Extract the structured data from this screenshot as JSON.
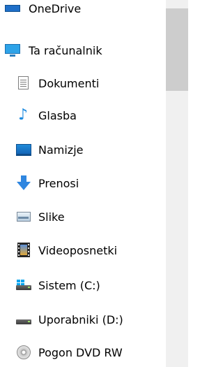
{
  "nav": {
    "partial_item": {
      "label": "OneDrive",
      "icon": "onedrive-icon"
    },
    "this_pc": {
      "label": "Ta računalnik",
      "icon": "computer-icon"
    },
    "items": [
      {
        "label": "Dokumenti",
        "icon": "documents-icon"
      },
      {
        "label": "Glasba",
        "icon": "music-icon"
      },
      {
        "label": "Namizje",
        "icon": "desktop-icon"
      },
      {
        "label": "Prenosi",
        "icon": "downloads-icon"
      },
      {
        "label": "Slike",
        "icon": "pictures-icon"
      },
      {
        "label": "Videoposnetki",
        "icon": "videos-icon"
      },
      {
        "label": "Sistem (C:)",
        "icon": "system-drive-icon"
      },
      {
        "label": "Uporabniki (D:)",
        "icon": "drive-icon"
      },
      {
        "label": "Pogon DVD RW",
        "icon": "dvd-drive-icon"
      }
    ]
  },
  "colors": {
    "background": "#ffffff",
    "scrollbar_track": "#f0f0f0",
    "scrollbar_thumb": "#cdcdcd",
    "accent": "#2ea3e8"
  }
}
